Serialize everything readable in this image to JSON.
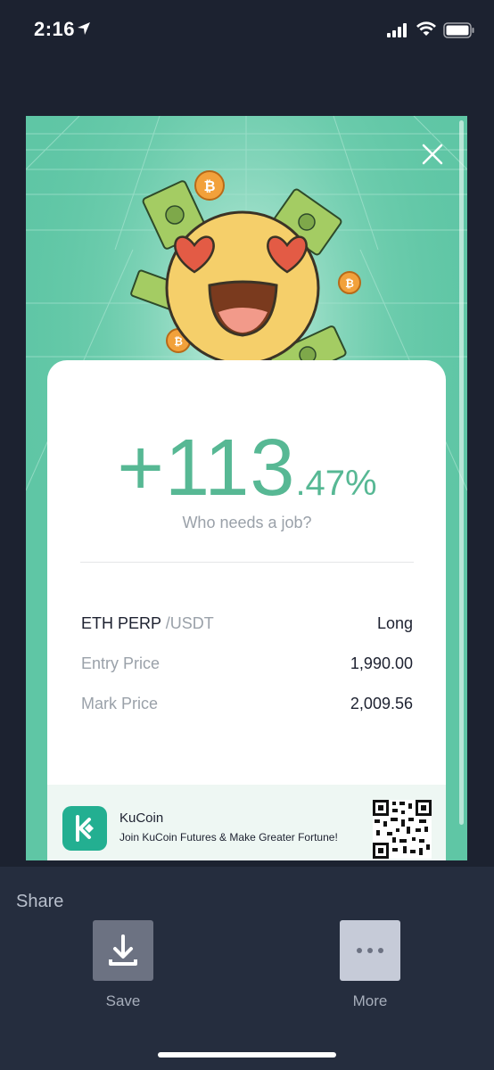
{
  "status_bar": {
    "time": "2:16"
  },
  "result": {
    "pnl_major": "+113",
    "pnl_minor": ".47%",
    "tagline": "Who needs a job?"
  },
  "position": {
    "pair": "ETH PERP",
    "quote": " /USDT",
    "side": "Long",
    "entry_label": "Entry Price",
    "entry_value": "1,990.00",
    "mark_label": "Mark Price",
    "mark_value": "2,009.56"
  },
  "promo": {
    "brand": "KuCoin",
    "slogan": "Join KuCoin Futures & Make Greater Fortune!"
  },
  "share": {
    "title": "Share",
    "save_label": "Save",
    "more_label": "More"
  },
  "colors": {
    "accent_green": "#57b894",
    "card_bg": "#5fc6a5",
    "sheet_bg": "#252d3e"
  }
}
